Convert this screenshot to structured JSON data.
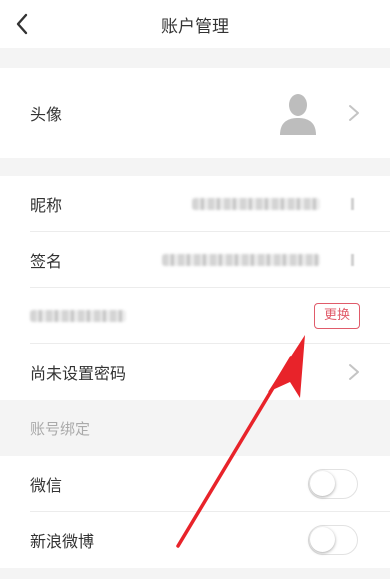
{
  "header": {
    "title": "账户管理",
    "back_icon": "back-arrow-icon"
  },
  "profile": {
    "avatar_label": "头像",
    "avatar_icon": "user-silhouette-icon"
  },
  "info": {
    "nickname_label": "昵称",
    "signature_label": "签名",
    "change_label": "更换",
    "password_label": "尚未设置密码"
  },
  "binding": {
    "section_title": "账号绑定",
    "wechat_label": "微信",
    "weibo_label": "新浪微博"
  },
  "colors": {
    "accent": "#e05b6a",
    "annotation_arrow": "#e8232a"
  }
}
